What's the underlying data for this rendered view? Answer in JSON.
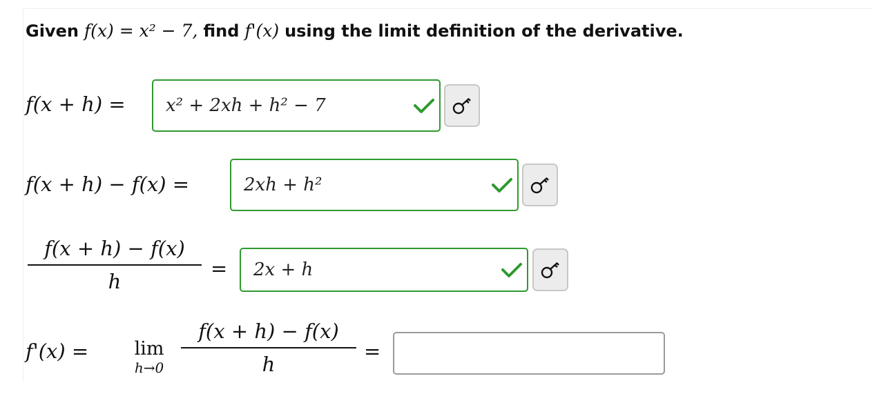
{
  "problem": {
    "prefix": "Given",
    "function_def": "f(x) = x² − 7,",
    "middle": "find",
    "target": "f'(x)",
    "suffix": "using the limit definition of the derivative."
  },
  "rows": [
    {
      "lhs": "f(x + h) =",
      "answer": "x² + 2xh + h² − 7",
      "status": "correct"
    },
    {
      "lhs": "f(x + h) − f(x) =",
      "answer": "2xh + h²",
      "status": "correct"
    },
    {
      "lhs_numerator": "f(x + h) − f(x)",
      "lhs_denominator": "h",
      "equals": "=",
      "answer": "2x + h",
      "status": "correct"
    },
    {
      "lhs": "f'(x) =",
      "lim_word": "lim",
      "lim_sub": "h→0",
      "numerator": "f(x + h) − f(x)",
      "denominator": "h",
      "equals": "=",
      "answer": "",
      "status": "empty"
    }
  ],
  "colors": {
    "correct_border": "#2e9a2e",
    "check_mark": "#2e9a2e",
    "empty_border": "#9a9a9a",
    "key_button_bg": "#ececec"
  },
  "icons": {
    "status": "checkmark-icon",
    "key_button": "key-icon"
  }
}
